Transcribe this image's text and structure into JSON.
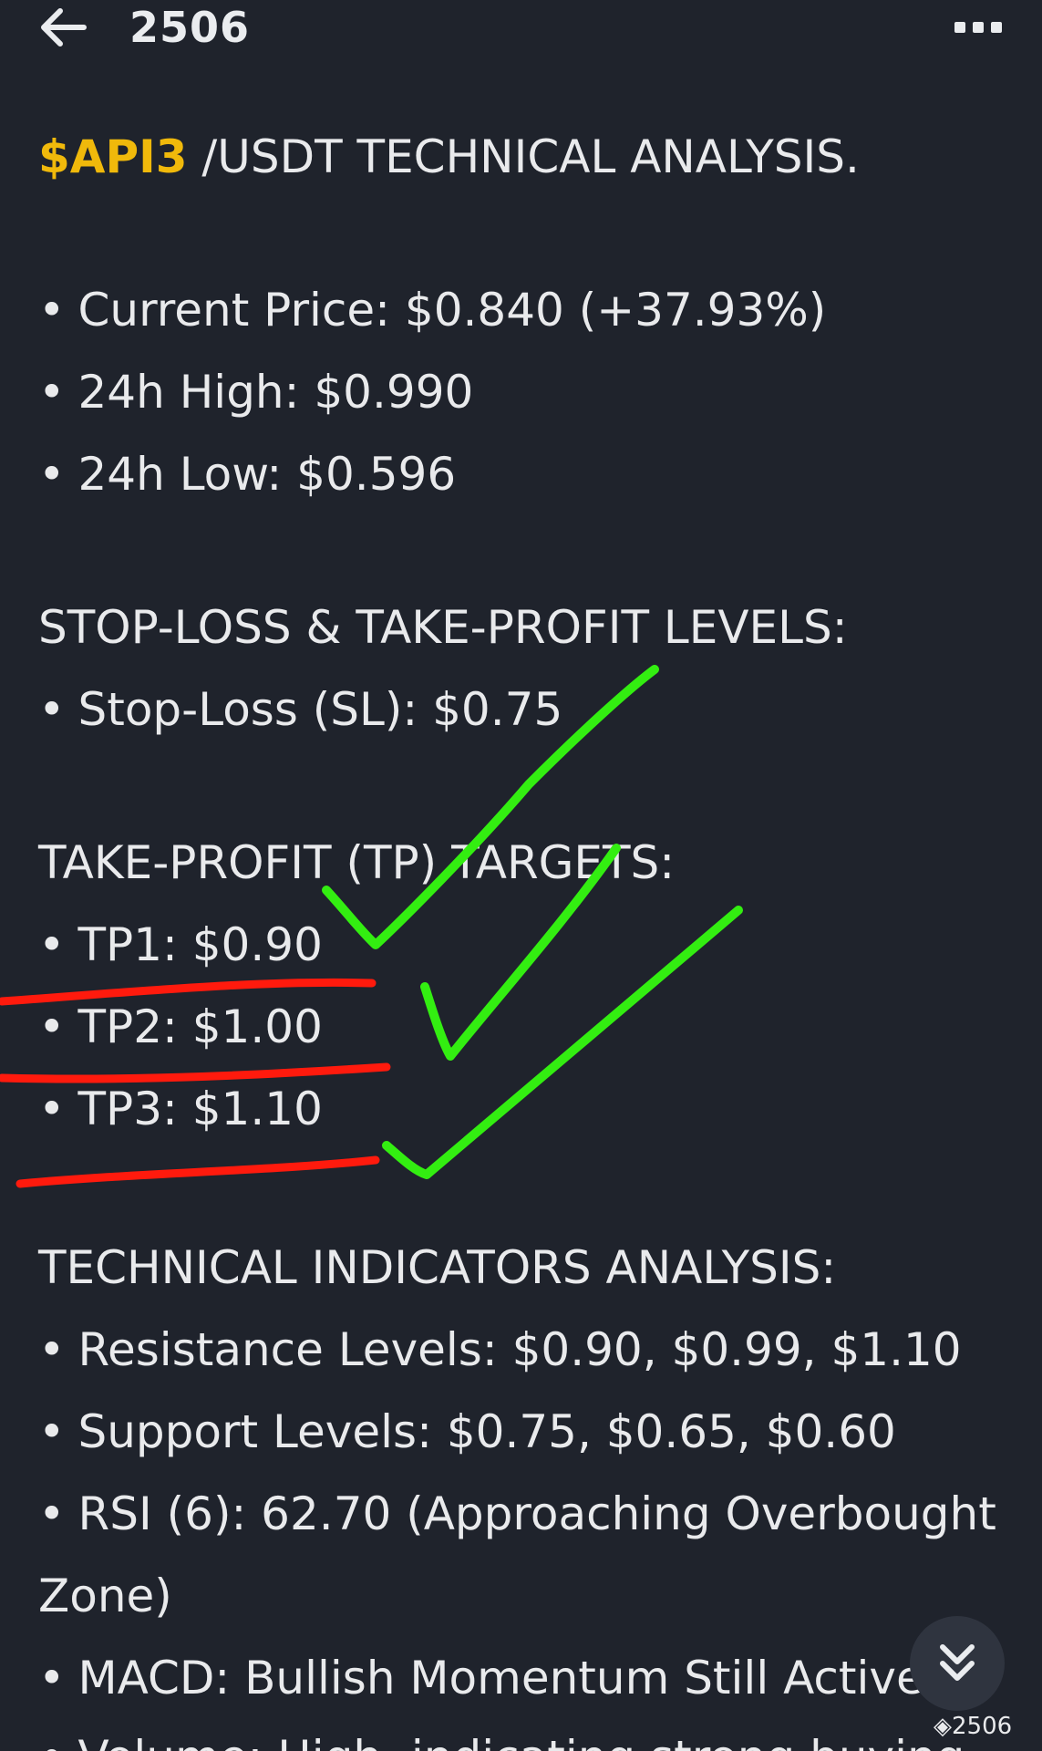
{
  "header": {
    "title": "2506",
    "back_icon": "arrow-left-icon",
    "more_icon": "more-dots-icon"
  },
  "article": {
    "title_ticker": "$API3",
    "title_rest": " /USDT TECHNICAL ANALYSIS.",
    "bullet": "•",
    "price_section": [
      "Current Price: $0.840 (+37.93%)",
      "24h High: $0.990",
      "24h Low: $0.596"
    ],
    "sl_heading": "STOP-LOSS & TAKE-PROFIT LEVELS:",
    "stop_loss": "Stop-Loss (SL): $0.75",
    "tp_heading": "TAKE-PROFIT (TP) TARGETS:",
    "tp_targets": [
      "TP1: $0.90",
      "TP2: $1.00",
      "TP3: $1.10"
    ],
    "ti_heading": "TECHNICAL INDICATORS ANALYSIS:",
    "indicators": [
      "Resistance Levels: $0.90, $0.99, $1.10",
      "Support Levels: $0.75, $0.65, $0.60",
      "RSI (6): 62.70 (Approaching Overbought",
      "MACD: Bullish Momentum Still Active"
    ],
    "rsi_continuation": "Zone)",
    "partial_last_line": "Volume: High, indicating strong buying"
  },
  "fab": {
    "icon": "chevron-double-down-icon"
  },
  "watermark": {
    "text": "2506"
  },
  "colors": {
    "background": "#1f232c",
    "text": "#e9eaec",
    "ticker": "#f0b90b",
    "annotation_check": "#33ee11",
    "annotation_underline": "#ff1a0d"
  }
}
